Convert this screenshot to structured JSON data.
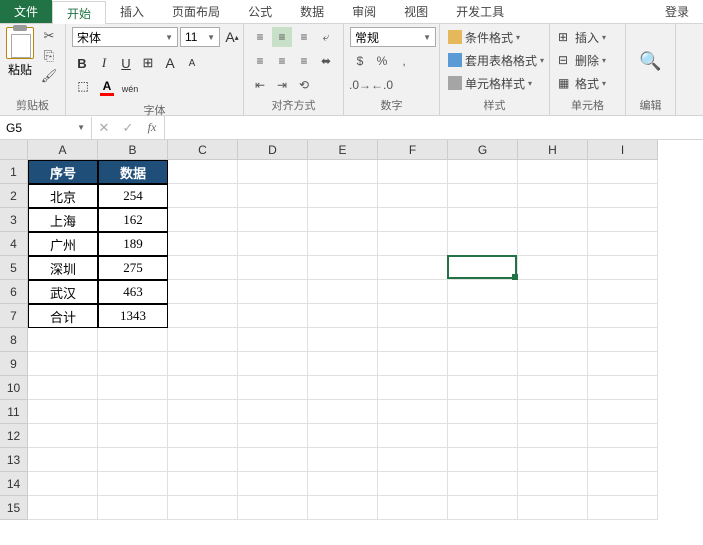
{
  "tabs": {
    "file": "文件",
    "home": "开始",
    "insert": "插入",
    "layout": "页面布局",
    "formula": "公式",
    "data": "数据",
    "review": "审阅",
    "view": "视图",
    "dev": "开发工具"
  },
  "login": "登录",
  "ribbon": {
    "clipboard": {
      "label": "剪贴板",
      "paste": "粘贴"
    },
    "font": {
      "label": "字体",
      "name": "宋体",
      "size": "11",
      "bold": "B",
      "italic": "I",
      "underline": "U",
      "grow": "A",
      "shrink": "A",
      "pinyin": "wén",
      "fill_color": "#ffff00",
      "font_color": "#ff0000"
    },
    "align": {
      "label": "对齐方式"
    },
    "number": {
      "label": "数字",
      "format": "常规"
    },
    "styles": {
      "label": "样式",
      "cond": "条件格式",
      "table": "套用表格格式",
      "cell": "单元格样式"
    },
    "cells": {
      "label": "单元格",
      "insert": "插入",
      "delete": "删除",
      "format": "格式"
    },
    "edit": {
      "label": "编辑"
    }
  },
  "name_box": "G5",
  "columns": [
    "A",
    "B",
    "C",
    "D",
    "E",
    "F",
    "G",
    "H",
    "I"
  ],
  "rows": [
    "1",
    "2",
    "3",
    "4",
    "5",
    "6",
    "7",
    "8",
    "9",
    "10",
    "11",
    "12",
    "13",
    "14",
    "15"
  ],
  "table": {
    "headers": [
      "序号",
      "数据"
    ],
    "rows": [
      [
        "北京",
        "254"
      ],
      [
        "上海",
        "162"
      ],
      [
        "广州",
        "189"
      ],
      [
        "深圳",
        "275"
      ],
      [
        "武汉",
        "463"
      ],
      [
        "合计",
        "1343"
      ]
    ]
  },
  "active_cell": {
    "col": 6,
    "row": 4
  }
}
